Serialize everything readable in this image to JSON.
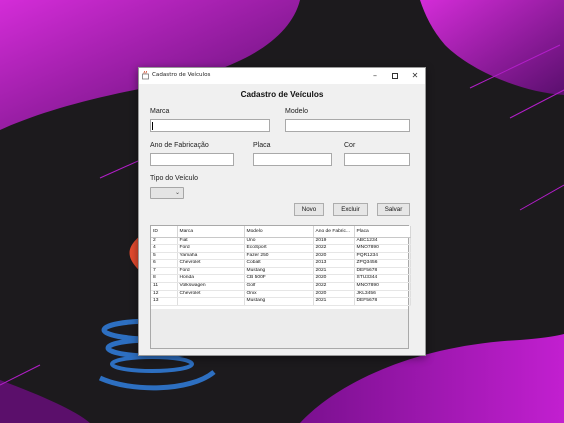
{
  "window": {
    "title": "Cadastro de Veículos",
    "controls": {
      "minimize": "–",
      "maximize": "",
      "close": "✕"
    }
  },
  "form": {
    "heading": "Cadastro de Veículos",
    "labels": {
      "marca": "Marca",
      "modelo": "Modelo",
      "ano": "Ano de Fabricação",
      "placa": "Placa",
      "cor": "Cor",
      "tipo": "Tipo do Veículo"
    },
    "values": {
      "marca": "",
      "modelo": "",
      "ano": "",
      "placa": "",
      "cor": "",
      "tipo": ""
    },
    "combo_arrow": "⌄"
  },
  "buttons": {
    "novo": "Novo",
    "excluir": "Excluir",
    "salvar": "Salvar"
  },
  "table": {
    "columns": [
      "ID",
      "Marca",
      "Modelo",
      "Ano de Fabric...",
      "Placa"
    ],
    "rows": [
      [
        "2",
        "Fiat",
        "Uno",
        "2019",
        "ABC1234"
      ],
      [
        "4",
        "Ford",
        "EcoSport",
        "2022",
        "MNO7890"
      ],
      [
        "5",
        "Yamaha",
        "Fazer 250",
        "2020",
        "PQR1234"
      ],
      [
        "6",
        "Chevrolet",
        "Cobalt",
        "2013",
        "ZPQ3456"
      ],
      [
        "7",
        "Ford",
        "Mustang",
        "2021",
        "DEF5678"
      ],
      [
        "8",
        "Honda",
        "CB 500F",
        "2020",
        "STU3344"
      ],
      [
        "11",
        "Volkswagen",
        "Golf",
        "2022",
        "MNO7890"
      ],
      [
        "12",
        "Chevrolet",
        "Onix",
        "2020",
        "JKL3456"
      ],
      [
        "13",
        "",
        "Mustang",
        "2021",
        "DEF5678"
      ]
    ]
  },
  "colors": {
    "background": "#1c1a1d",
    "accent_magenta": "#b21ec8",
    "java_red": "#e24a2e",
    "java_blue": "#2d6fc1"
  }
}
